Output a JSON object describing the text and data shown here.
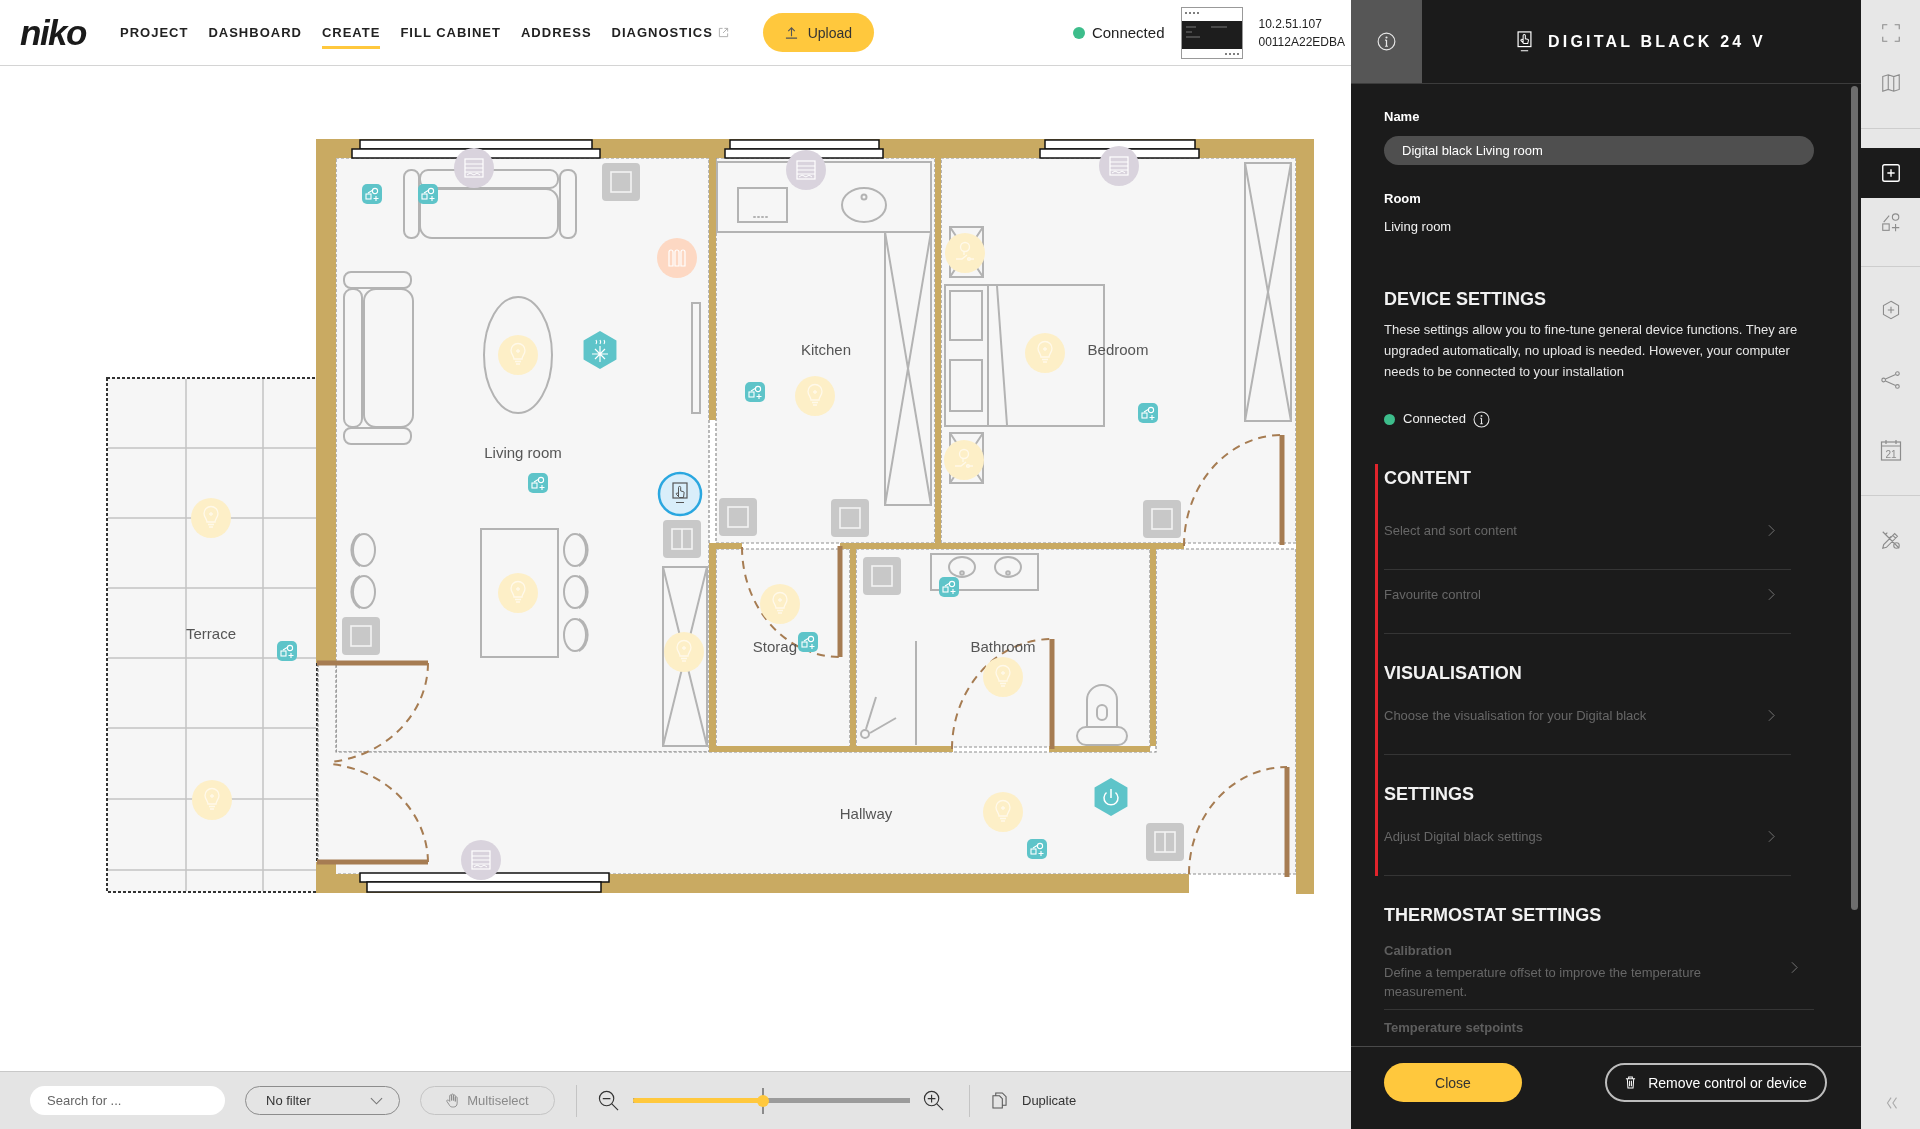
{
  "top_bar": {
    "logo": "niko",
    "nav": [
      {
        "label": "PROJECT",
        "selected": false,
        "external": false
      },
      {
        "label": "DASHBOARD",
        "selected": false,
        "external": false
      },
      {
        "label": "CREATE",
        "selected": true,
        "external": false
      },
      {
        "label": "FILL CABINET",
        "selected": false,
        "external": false
      },
      {
        "label": "ADDRESS",
        "selected": false,
        "external": false
      },
      {
        "label": "DIAGNOSTICS",
        "selected": false,
        "external": true
      }
    ],
    "upload_button": "Upload",
    "status": {
      "label": "Connected",
      "color": "#3dbd8b"
    },
    "controller": {
      "address": "10.2.51.107",
      "serial": "00112A22EDBA"
    }
  },
  "floor_plan": {
    "rooms": [
      {
        "name": "Kitchen"
      },
      {
        "name": "Bedroom"
      },
      {
        "name": "Living room"
      },
      {
        "name": "Terrace"
      },
      {
        "name": "Storag"
      },
      {
        "name": "Bathroom"
      },
      {
        "name": "Hallway"
      }
    ],
    "devices": [
      {
        "kind": "blind",
        "selected": false
      },
      {
        "kind": "action",
        "selected": false
      },
      {
        "kind": "action",
        "selected": false
      },
      {
        "kind": "switch",
        "selected": false
      },
      {
        "kind": "heater",
        "selected": false
      },
      {
        "kind": "light",
        "selected": false
      },
      {
        "kind": "climate",
        "selected": false
      },
      {
        "kind": "action",
        "selected": false
      },
      {
        "kind": "touch-panel",
        "selected": true
      },
      {
        "kind": "double-switch",
        "selected": false
      },
      {
        "kind": "light",
        "selected": false
      },
      {
        "kind": "light",
        "selected": false
      },
      {
        "kind": "switch",
        "selected": false
      },
      {
        "kind": "blind",
        "selected": false
      },
      {
        "kind": "light",
        "selected": false
      },
      {
        "kind": "light",
        "selected": false
      },
      {
        "kind": "action",
        "selected": false
      },
      {
        "kind": "blind",
        "selected": false
      },
      {
        "kind": "action",
        "selected": false
      },
      {
        "kind": "light",
        "selected": false
      },
      {
        "kind": "switch",
        "selected": false
      },
      {
        "kind": "switch",
        "selected": false
      },
      {
        "kind": "blind",
        "selected": false
      },
      {
        "kind": "lamp",
        "selected": false
      },
      {
        "kind": "light",
        "selected": false
      },
      {
        "kind": "action",
        "selected": false
      },
      {
        "kind": "lamp",
        "selected": false
      },
      {
        "kind": "switch",
        "selected": false
      },
      {
        "kind": "light",
        "selected": false
      },
      {
        "kind": "action",
        "selected": false
      },
      {
        "kind": "switch",
        "selected": false
      },
      {
        "kind": "action",
        "selected": false
      },
      {
        "kind": "light",
        "selected": false
      },
      {
        "kind": "light",
        "selected": false
      },
      {
        "kind": "power",
        "selected": false
      },
      {
        "kind": "action",
        "selected": false
      },
      {
        "kind": "double-switch",
        "selected": false
      }
    ]
  },
  "toolbar": {
    "search": {
      "placeholder": "Search for ..."
    },
    "filter": {
      "value": "No filter"
    },
    "multiselect": {
      "label": "Multiselect",
      "disabled": true
    },
    "zoom": {
      "level": 0.47
    },
    "duplicate": "Duplicate"
  },
  "device_panel": {
    "title": "DIGITAL BLACK 24 V",
    "name_label": "Name",
    "name_value": "Digital black Living room",
    "room_label": "Room",
    "room_value": "Living room",
    "sections": [
      {
        "kind": "info",
        "title": "DEVICE SETTINGS",
        "description": "These settings allow you to fine-tune general device functions. They are upgraded automatically, no upload is needed. However, your computer needs to be connected to your installation",
        "status": {
          "label": "Connected",
          "color": "#3dbd8b"
        }
      },
      {
        "kind": "links",
        "title": "CONTENT",
        "flagged": true,
        "items": [
          {
            "label": "Select and sort content"
          },
          {
            "label": "Favourite control"
          }
        ]
      },
      {
        "kind": "links",
        "title": "VISUALISATION",
        "flagged": true,
        "items": [
          {
            "label": "Choose the visualisation for your Digital black"
          }
        ]
      },
      {
        "kind": "links",
        "title": "SETTINGS",
        "flagged": true,
        "items": [
          {
            "label": "Adjust Digital black settings"
          }
        ]
      },
      {
        "kind": "links",
        "title": "THERMOSTAT SETTINGS",
        "flagged": false,
        "items": [
          {
            "title": "Calibration",
            "label": "Define a temperature offset to improve the temperature measurement."
          },
          {
            "title": "Temperature setpoints"
          }
        ]
      }
    ],
    "buttons": {
      "close": "Close",
      "remove": "Remove control or device"
    }
  },
  "side_tools": [
    {
      "kind": "fullscreen",
      "selected": false
    },
    {
      "kind": "map",
      "selected": false
    },
    {
      "kind": "add",
      "selected": true
    },
    {
      "kind": "add-shape",
      "selected": false
    },
    {
      "kind": "add-hex",
      "selected": false
    },
    {
      "kind": "nodes",
      "selected": false
    },
    {
      "kind": "calendar",
      "selected": false,
      "label": "21"
    },
    {
      "kind": "tools",
      "selected": false
    }
  ]
}
